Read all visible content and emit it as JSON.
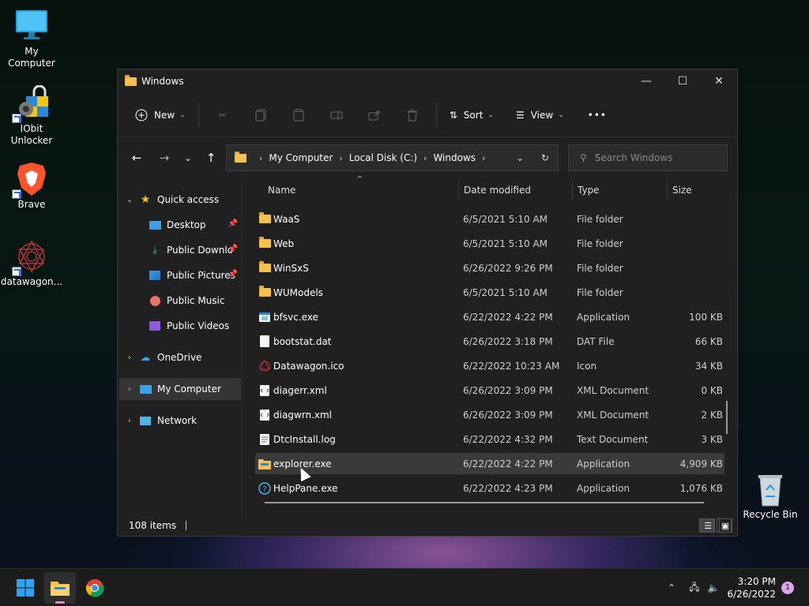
{
  "desktop": {
    "icons": [
      {
        "label": "My Computer"
      },
      {
        "label": "IObit\nUnlocker"
      },
      {
        "label": "Brave"
      },
      {
        "label": "datawagon..."
      },
      {
        "label": "Recycle Bin"
      }
    ]
  },
  "window": {
    "title": "Windows",
    "controls": {
      "minimize": "—",
      "maximize": "☐",
      "close": "✕"
    }
  },
  "toolbar": {
    "new_label": "New",
    "sort_label": "Sort",
    "view_label": "View",
    "more_label": "•••"
  },
  "address": {
    "crumbs": [
      "My Computer",
      "Local Disk (C:)",
      "Windows"
    ],
    "search_placeholder": "Search Windows"
  },
  "navpane": {
    "quick_access": "Quick access",
    "items": [
      {
        "label": "Desktop"
      },
      {
        "label": "Public Downloads"
      },
      {
        "label": "Public Pictures"
      },
      {
        "label": "Public Music"
      },
      {
        "label": "Public Videos"
      }
    ],
    "onedrive": "OneDrive",
    "mycomputer": "My Computer",
    "network": "Network"
  },
  "columns": {
    "name": "Name",
    "date": "Date modified",
    "type": "Type",
    "size": "Size"
  },
  "files": [
    {
      "name": "WaaS",
      "date": "6/5/2021 5:10 AM",
      "type": "File folder",
      "size": "",
      "icon": "folder-icon"
    },
    {
      "name": "Web",
      "date": "6/5/2021 5:10 AM",
      "type": "File folder",
      "size": "",
      "icon": "folder-icon"
    },
    {
      "name": "WinSxS",
      "date": "6/26/2022 9:26 PM",
      "type": "File folder",
      "size": "",
      "icon": "folder-icon"
    },
    {
      "name": "WUModels",
      "date": "6/5/2021 5:10 AM",
      "type": "File folder",
      "size": "",
      "icon": "folder-icon"
    },
    {
      "name": "bfsvc.exe",
      "date": "6/22/2022 4:22 PM",
      "type": "Application",
      "size": "100 KB",
      "icon": "app-icon"
    },
    {
      "name": "bootstat.dat",
      "date": "6/26/2022 3:18 PM",
      "type": "DAT File",
      "size": "66 KB",
      "icon": "file-icon"
    },
    {
      "name": "Datawagon.ico",
      "date": "6/22/2022 10:23 AM",
      "type": "Icon",
      "size": "34 KB",
      "icon": "ico-icon"
    },
    {
      "name": "diagerr.xml",
      "date": "6/26/2022 3:09 PM",
      "type": "XML Document",
      "size": "0 KB",
      "icon": "xml-icon"
    },
    {
      "name": "diagwrn.xml",
      "date": "6/26/2022 3:09 PM",
      "type": "XML Document",
      "size": "2 KB",
      "icon": "xml-icon"
    },
    {
      "name": "DtcInstall.log",
      "date": "6/22/2022 4:32 PM",
      "type": "Text Document",
      "size": "3 KB",
      "icon": "text-icon"
    },
    {
      "name": "explorer.exe",
      "date": "6/22/2022 4:22 PM",
      "type": "Application",
      "size": "4,909 KB",
      "icon": "explorer-icon"
    },
    {
      "name": "HelpPane.exe",
      "date": "6/22/2022 4:23 PM",
      "type": "Application",
      "size": "1,076 KB",
      "icon": "help-icon"
    }
  ],
  "status": {
    "items": "108 items"
  },
  "taskbar": {
    "time": "3:20 PM",
    "date": "6/26/2022",
    "notifications": "1"
  },
  "colors": {
    "accent": "#0078d4",
    "folder": "#f2c14e",
    "window_bg": "#202020",
    "taskbar_bg": "#1c1c1c"
  }
}
